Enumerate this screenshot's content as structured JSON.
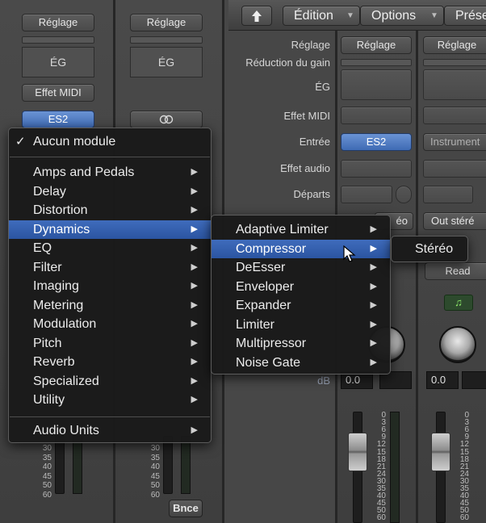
{
  "mixer": {
    "strip1": {
      "setting": "Réglage",
      "eq": "ÉG",
      "midi_effect": "Effet MIDI",
      "instrument": "ES2"
    },
    "strip2": {
      "setting": "Réglage",
      "eq": "ÉG",
      "output_label": "Bnce"
    },
    "labels": {
      "setting": "Réglage",
      "gain_reduction": "Réduction du gain",
      "eq": "ÉG",
      "midi_effect": "Effet MIDI",
      "input": "Entrée",
      "audio_effect": "Effet audio",
      "sends": "Départs",
      "db": "dB"
    },
    "strip3": {
      "setting": "Réglage",
      "input": "ES2",
      "output": "éo",
      "value": "0.0"
    },
    "strip4": {
      "setting": "Réglage",
      "input": "Instrument",
      "output": "Out stéré",
      "automation": "Read",
      "value": "0.0"
    },
    "left_scale": [
      "30",
      "35",
      "40",
      "45",
      "50",
      "60"
    ],
    "mid_scale": [
      "30",
      "35",
      "40",
      "45",
      "50",
      "60"
    ],
    "right_scale": [
      "0",
      "3",
      "6",
      "9",
      "12",
      "15",
      "18",
      "21",
      "24",
      "30",
      "35",
      "40",
      "45",
      "50",
      "60"
    ],
    "right2_scale": [
      "0",
      "3",
      "6",
      "9",
      "12",
      "15",
      "18",
      "21",
      "24",
      "30",
      "35",
      "40",
      "45",
      "50",
      "60"
    ]
  },
  "toolbar": {
    "back_icon": "up-arrow-icon",
    "edit": "Édition",
    "options": "Options",
    "presets": "Prése"
  },
  "menu": {
    "none_item": "Aucun module",
    "categories": [
      "Amps and Pedals",
      "Delay",
      "Distortion",
      "Dynamics",
      "EQ",
      "Filter",
      "Imaging",
      "Metering",
      "Modulation",
      "Pitch",
      "Reverb",
      "Specialized",
      "Utility"
    ],
    "audio_units": "Audio Units",
    "dynamics": [
      "Adaptive Limiter",
      "Compressor",
      "DeEsser",
      "Enveloper",
      "Expander",
      "Limiter",
      "Multipressor",
      "Noise Gate"
    ],
    "compressor": [
      "Stéréo"
    ]
  },
  "colors": {
    "highlight": "#3262b3",
    "menu_bg": "#1a1a1a",
    "active_input": "#4a79c4"
  }
}
